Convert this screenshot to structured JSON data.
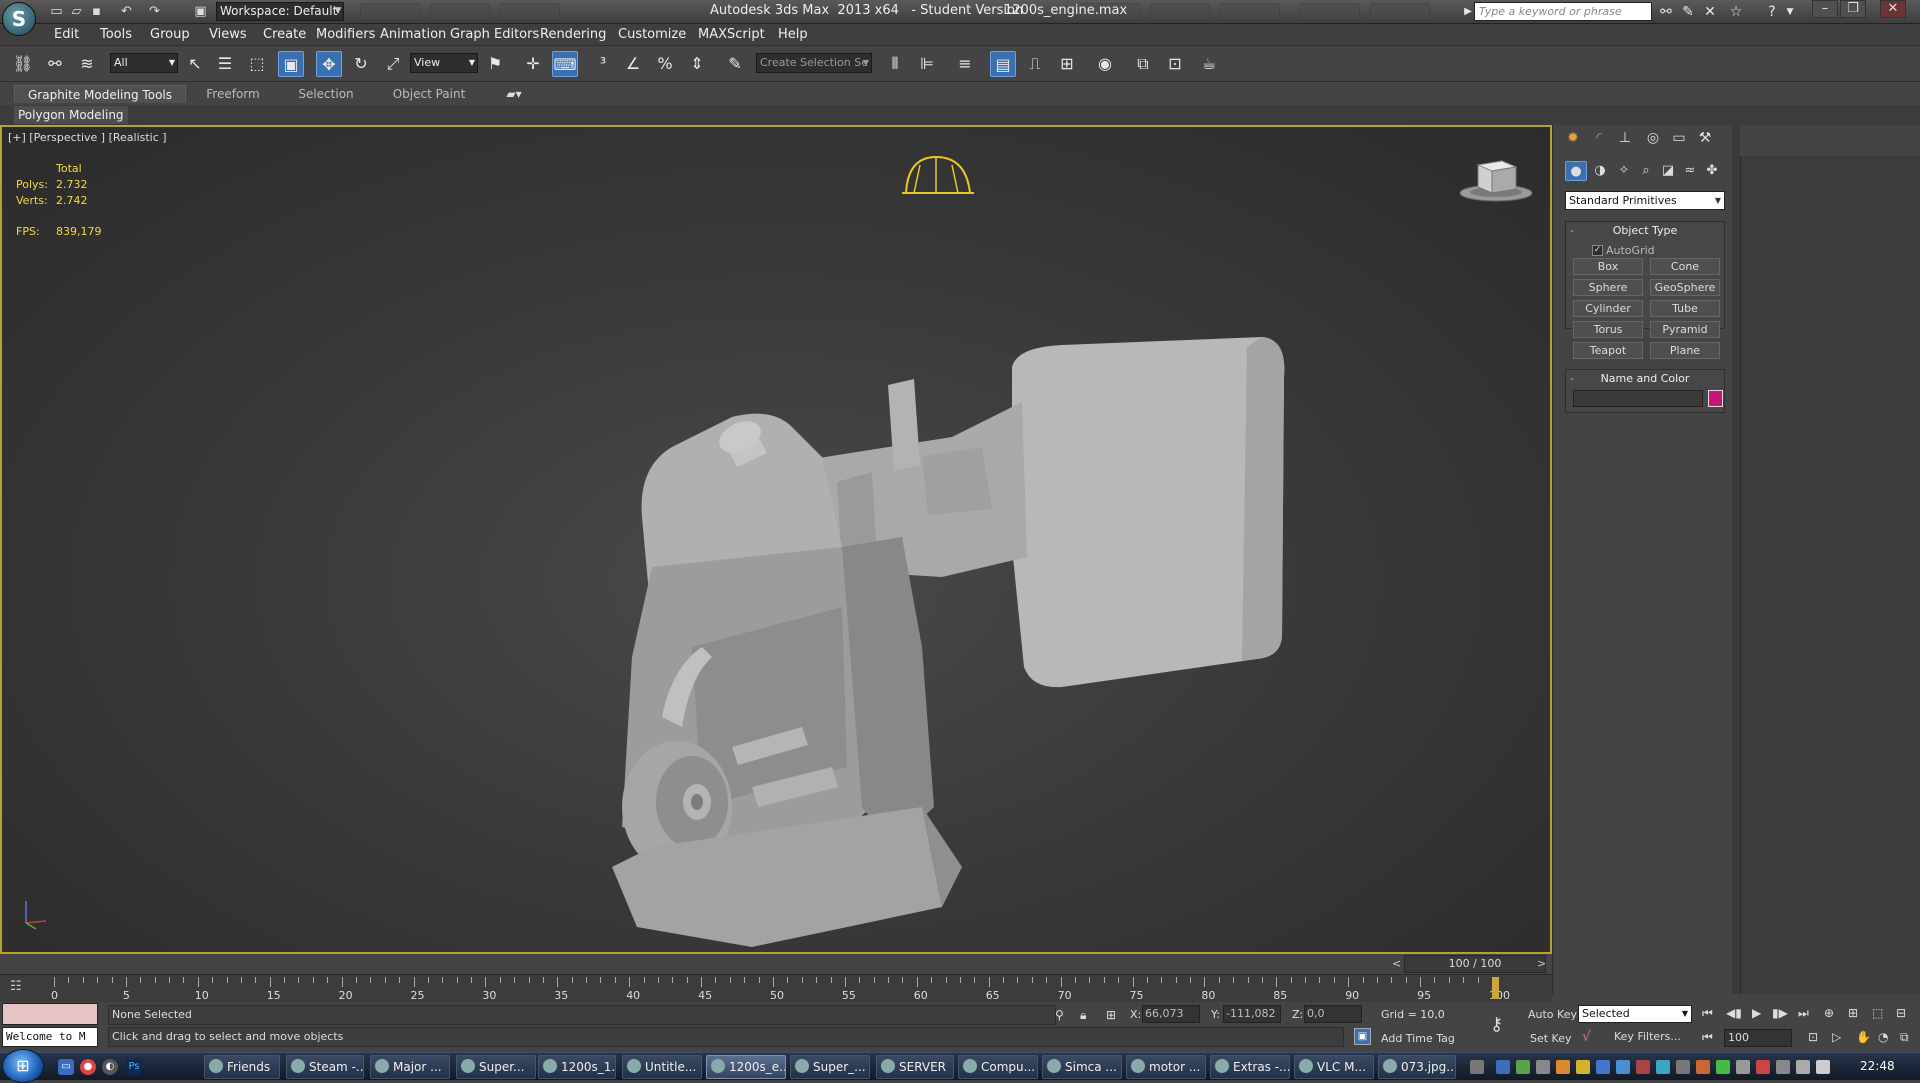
{
  "titlebar": {
    "workspace": "Workspace: Default",
    "app_title": "Autodesk 3ds Max  2013 x64   - Student Version",
    "file_name": "1200s_engine.max",
    "search_placeholder": "Type a keyword or phrase"
  },
  "menubar": [
    "Edit",
    "Tools",
    "Group",
    "Views",
    "Create",
    "Modifiers",
    "Animation",
    "Graph Editors",
    "Rendering",
    "Customize",
    "MAXScript",
    "Help"
  ],
  "toolbar": {
    "selection_filter": "All",
    "reference_coord": "View",
    "named_selection": "Create Selection Se"
  },
  "ribbon": {
    "tabs": [
      "Graphite Modeling Tools",
      "Freeform",
      "Selection",
      "Object Paint"
    ],
    "active_tab": "Graphite Modeling Tools",
    "subtab": "Polygon Modeling"
  },
  "viewport": {
    "label": "[+] [Perspective ] [Realistic ]",
    "stats": {
      "header": "Total",
      "polys_label": "Polys:",
      "polys": "2.732",
      "verts_label": "Verts:",
      "verts": "2.742",
      "fps_label": "FPS:",
      "fps": "839,179"
    }
  },
  "command_panel": {
    "category": "Standard Primitives",
    "object_type_title": "Object Type",
    "autogrid_label": "AutoGrid",
    "autogrid_checked": true,
    "primitives": [
      "Box",
      "Cone",
      "Sphere",
      "GeoSphere",
      "Cylinder",
      "Tube",
      "Torus",
      "Pyramid",
      "Teapot",
      "Plane"
    ],
    "name_color_title": "Name and Color",
    "object_color": "#c8157a"
  },
  "timeline": {
    "slider_text": "100 / 100",
    "current_frame": 100,
    "ticks": [
      "0",
      "5",
      "10",
      "15",
      "20",
      "25",
      "30",
      "35",
      "40",
      "45",
      "50",
      "55",
      "60",
      "65",
      "70",
      "75",
      "80",
      "85",
      "90",
      "95",
      "100"
    ]
  },
  "status": {
    "maxscript_output": "Welcome to M",
    "selection": "None Selected",
    "prompt": "Click and drag to select and move objects",
    "x_label": "X:",
    "x": "66,073",
    "y_label": "Y:",
    "y": "-111,082",
    "z_label": "Z:",
    "z": "0,0",
    "grid": "Grid = 10,0",
    "add_time_tag": "Add Time Tag"
  },
  "animation": {
    "auto_key": "Auto Key",
    "set_key": "Set Key",
    "set_key_filter": "Selected",
    "key_filters": "Key Filters...",
    "frame": "100"
  },
  "taskbar": {
    "buttons": [
      "Friends",
      "Steam -...",
      "Major ...",
      "Super...",
      "1200s_1...",
      "Untitle...",
      "1200s_e...",
      "Super_...",
      "SERVER",
      "Compu...",
      "Simca ...",
      "motor ...",
      "Extras -...",
      "VLC M...",
      "073.jpg..."
    ],
    "active": "1200s_e...",
    "clock": "22:48"
  }
}
